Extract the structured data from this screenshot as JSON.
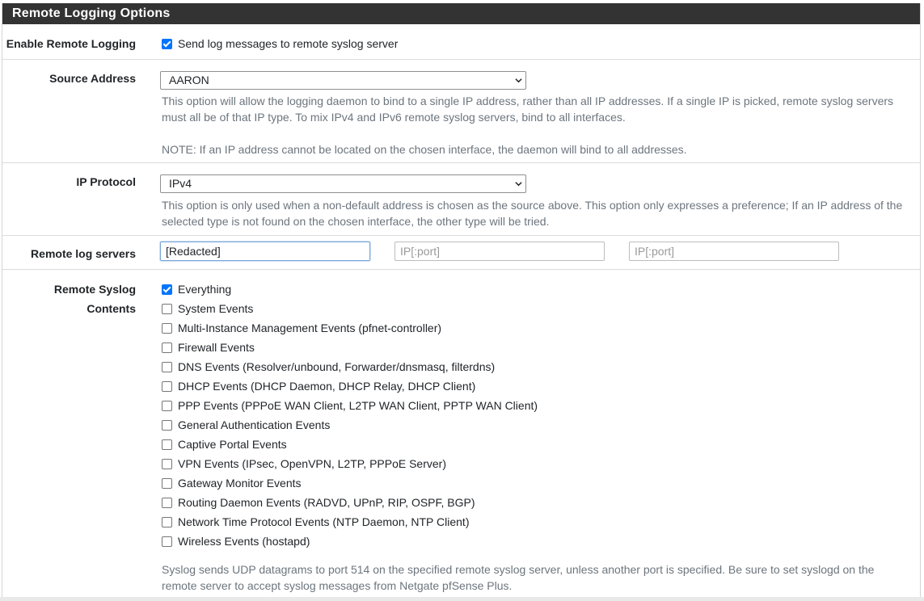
{
  "panel": {
    "title": "Remote Logging Options"
  },
  "enable": {
    "label": "Enable Remote Logging",
    "checkbox_label": "Send log messages to remote syslog server",
    "checked": true
  },
  "source": {
    "label": "Source Address",
    "selected": "AARON",
    "help1": "This option will allow the logging daemon to bind to a single IP address, rather than all IP addresses. If a single IP is picked, remote syslog servers must all be of that IP type. To mix IPv4 and IPv6 remote syslog servers, bind to all interfaces.",
    "help2": "NOTE: If an IP address cannot be located on the chosen interface, the daemon will bind to all addresses."
  },
  "protocol": {
    "label": "IP Protocol",
    "selected": "IPv4",
    "help": "This option is only used when a non-default address is chosen as the source above. This option only expresses a preference; If an IP address of the selected type is not found on the chosen interface, the other type will be tried."
  },
  "servers": {
    "label": "Remote log servers",
    "server1_value": "[Redacted]",
    "server2_placeholder": "IP[:port]",
    "server3_placeholder": "IP[:port]"
  },
  "contents": {
    "label": "Remote Syslog Contents",
    "items": [
      {
        "label": "Everything",
        "checked": true
      },
      {
        "label": "System Events",
        "checked": false
      },
      {
        "label": "Multi-Instance Management Events (pfnet-controller)",
        "checked": false
      },
      {
        "label": "Firewall Events",
        "checked": false
      },
      {
        "label": "DNS Events (Resolver/unbound, Forwarder/dnsmasq, filterdns)",
        "checked": false
      },
      {
        "label": "DHCP Events (DHCP Daemon, DHCP Relay, DHCP Client)",
        "checked": false
      },
      {
        "label": "PPP Events (PPPoE WAN Client, L2TP WAN Client, PPTP WAN Client)",
        "checked": false
      },
      {
        "label": "General Authentication Events",
        "checked": false
      },
      {
        "label": "Captive Portal Events",
        "checked": false
      },
      {
        "label": "VPN Events (IPsec, OpenVPN, L2TP, PPPoE Server)",
        "checked": false
      },
      {
        "label": "Gateway Monitor Events",
        "checked": false
      },
      {
        "label": "Routing Daemon Events (RADVD, UPnP, RIP, OSPF, BGP)",
        "checked": false
      },
      {
        "label": "Network Time Protocol Events (NTP Daemon, NTP Client)",
        "checked": false
      },
      {
        "label": "Wireless Events (hostapd)",
        "checked": false
      }
    ],
    "help": "Syslog sends UDP datagrams to port 514 on the specified remote syslog server, unless another port is specified. Be sure to set syslogd on the remote server to accept syslog messages from Netgate pfSense Plus."
  }
}
